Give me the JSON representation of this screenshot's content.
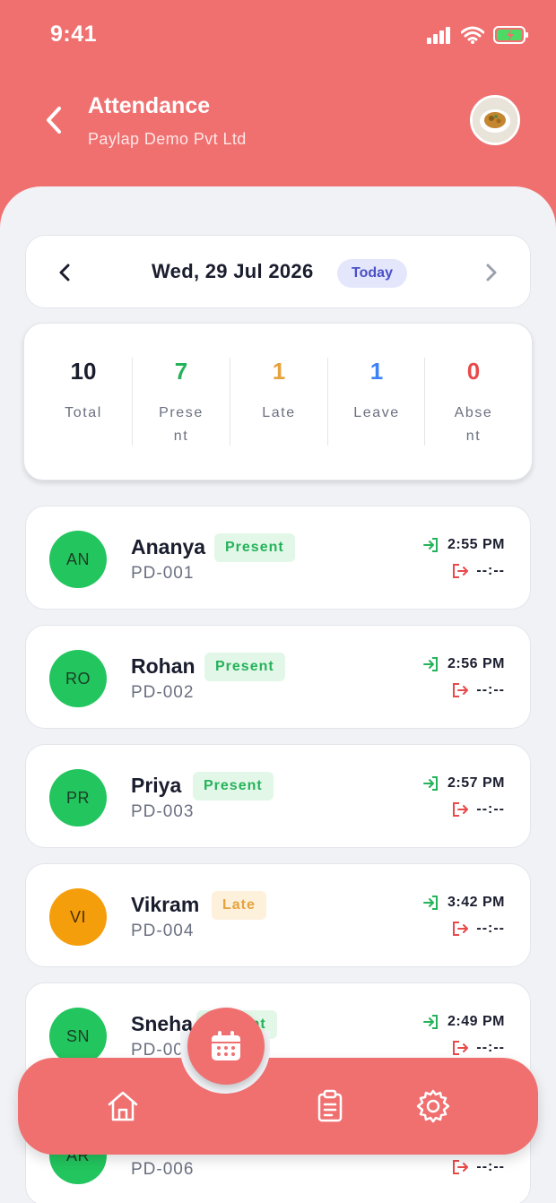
{
  "status_bar": {
    "time": "9:41"
  },
  "header": {
    "title": "Attendance",
    "subtitle": "Paylap Demo Pvt Ltd"
  },
  "date_nav": {
    "date": "Wed, 29 Jul 2026",
    "today_label": "Today"
  },
  "summary": [
    {
      "value": "10",
      "label": "Total",
      "color": "#1a1d2e"
    },
    {
      "value": "7",
      "label": "Prese nt",
      "color": "#25b35a"
    },
    {
      "value": "1",
      "label": "Late",
      "color": "#e6a23c"
    },
    {
      "value": "1",
      "label": "Leave",
      "color": "#3b82f6"
    },
    {
      "value": "0",
      "label": "Abse nt",
      "color": "#e84a4a"
    }
  ],
  "employees": [
    {
      "initials": "AN",
      "name": "Ananya",
      "id": "PD-001",
      "status": "Present",
      "check_in": "2:55 PM",
      "check_out": "--:--"
    },
    {
      "initials": "RO",
      "name": "Rohan",
      "id": "PD-002",
      "status": "Present",
      "check_in": "2:56 PM",
      "check_out": "--:--"
    },
    {
      "initials": "PR",
      "name": "Priya",
      "id": "PD-003",
      "status": "Present",
      "check_in": "2:57 PM",
      "check_out": "--:--"
    },
    {
      "initials": "VI",
      "name": "Vikram",
      "id": "PD-004",
      "status": "Late",
      "check_in": "3:42 PM",
      "check_out": "--:--"
    },
    {
      "initials": "SN",
      "name": "Sneha",
      "id": "PD-005",
      "status": "Present",
      "check_in": "2:49 PM",
      "check_out": "--:--"
    },
    {
      "initials": "AR",
      "name": "",
      "id": "PD-006",
      "status": "",
      "check_in": "",
      "check_out": "--:--"
    }
  ],
  "colors": {
    "accent": "#f07070",
    "present": "#25b35a",
    "late": "#f59e0b",
    "check_in": "#25b35a",
    "check_out": "#e84a4a"
  },
  "nav": {
    "items": [
      "home-icon",
      "calendar-icon",
      "clipboard-icon",
      "gear-icon"
    ]
  }
}
